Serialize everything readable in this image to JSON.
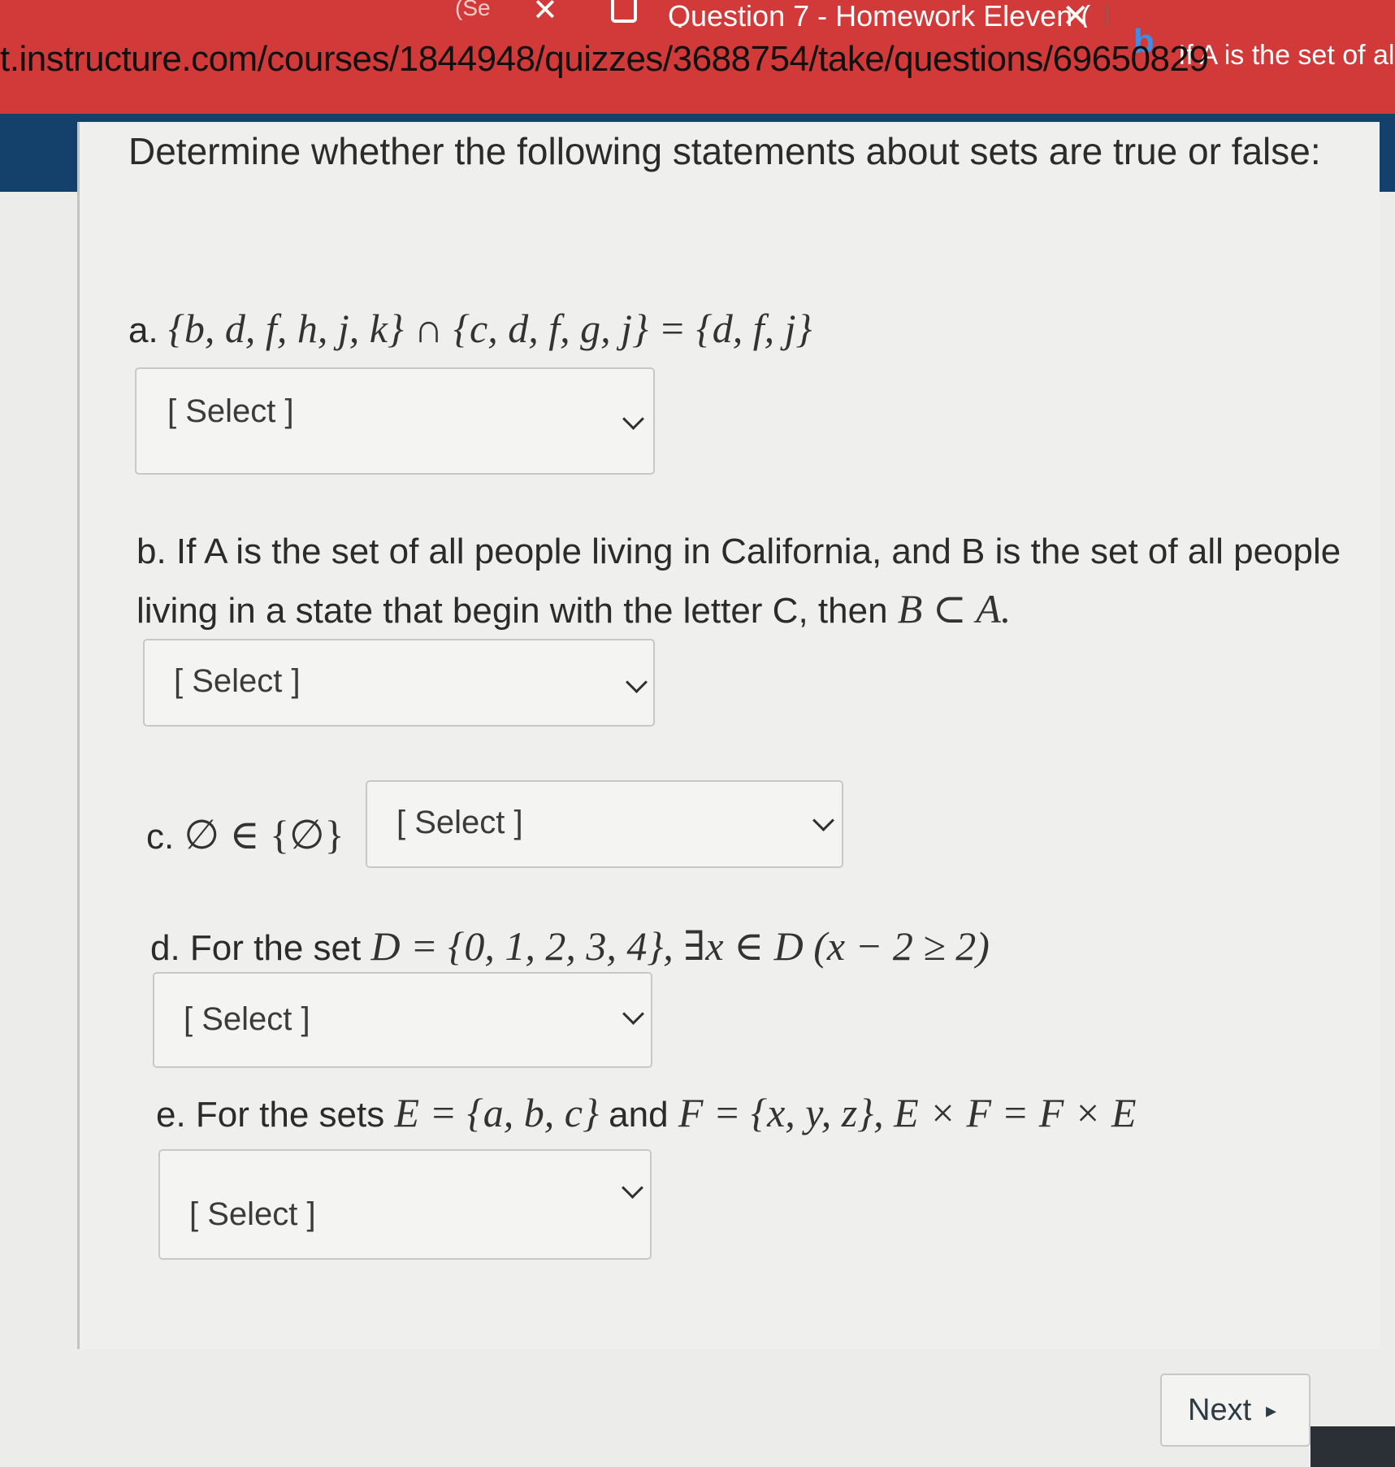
{
  "browser": {
    "prev_tab_label": "(Se",
    "active_tab_title": "Question 7 - Homework Eleven (",
    "next_tab_title": "If A is the set of all pe",
    "url": "t.instructure.com/courses/1844948/quizzes/3688754/take/questions/69650829"
  },
  "quiz": {
    "prompt": "Determine whether the following statements about sets are true or false:",
    "select_placeholder": "[ Select ]",
    "questions": [
      {
        "id": "a",
        "label": "a.",
        "math": "{b, d, f, h, j, k} ∩ {c, d, f, g, j} = {d, f, j}"
      },
      {
        "id": "b",
        "line1": "b. If A is the set of all people living in California, and B is the set of all people",
        "line2": "living in a state that begin with the letter C, then ",
        "math": "B ⊂ A."
      },
      {
        "id": "c",
        "label": "c.",
        "math": "∅ ∈ {∅}"
      },
      {
        "id": "d",
        "text": "d. For the set ",
        "math": "D = {0, 1, 2, 3, 4}, ∃x ∈ D (x − 2 ≥ 2)"
      },
      {
        "id": "e",
        "text": "e. For the sets ",
        "math_1": "E = {a, b, c}",
        "joiner": " and ",
        "math_2": "F = {x, y, z}, E × F = F × E"
      }
    ],
    "next_label": "Next",
    "next_icon": "triangle-right-icon"
  },
  "colors": {
    "tab_red": "#d23a3a",
    "url_band": "#14416b",
    "card_background": "#efefed"
  }
}
